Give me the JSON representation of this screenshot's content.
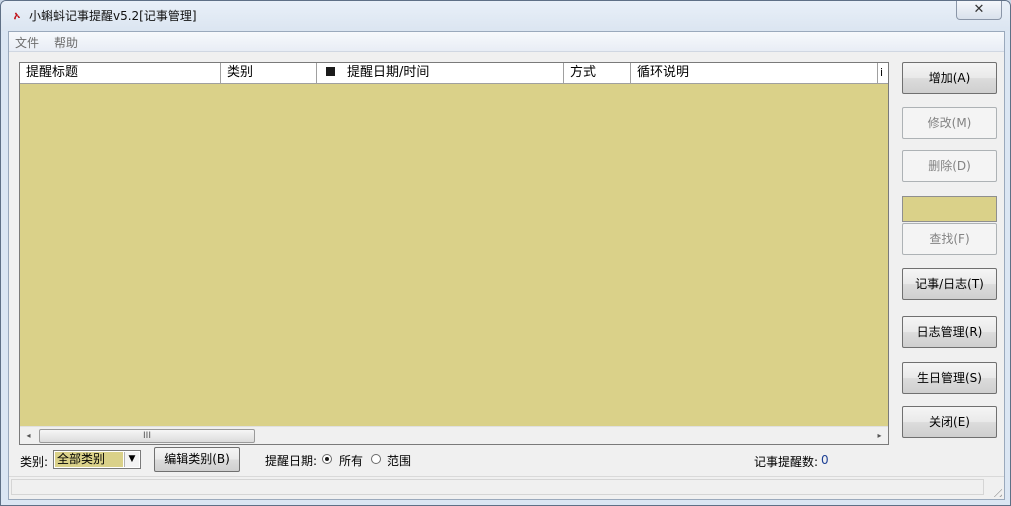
{
  "window": {
    "title": "小蝌蚪记事提醒v5.2[记事管理]",
    "close_glyph": "✕",
    "icon": "app-red-icon"
  },
  "menu": {
    "items": [
      "文件",
      "帮助"
    ]
  },
  "grid": {
    "columns": [
      "提醒标题",
      "类别",
      "提醒日期/时间",
      "方式",
      "循环说明",
      "i"
    ],
    "rows": [],
    "background_color": "#dad189",
    "scrollbar": {
      "left_arrow": "◂",
      "right_arrow": "▸",
      "thumb_grip": "III"
    }
  },
  "buttons": {
    "add": "增加(A)",
    "modify": "修改(M)",
    "delete": "删除(D)",
    "find": "查找(F)",
    "notes_diary": "记事/日志(T)",
    "diary_manage": "日志管理(R)",
    "birthday_manage": "生日管理(S)",
    "close": "关闭(E)"
  },
  "filter": {
    "category_label": "类别:",
    "category_value": "全部类别",
    "combo_arrow": "▼",
    "edit_category_button": "编辑类别(B)",
    "date_label": "提醒日期:",
    "radio_all": "所有",
    "radio_range": "范围",
    "selected": "所有"
  },
  "summary": {
    "count_label": "记事提醒数:",
    "count_value": "0"
  }
}
